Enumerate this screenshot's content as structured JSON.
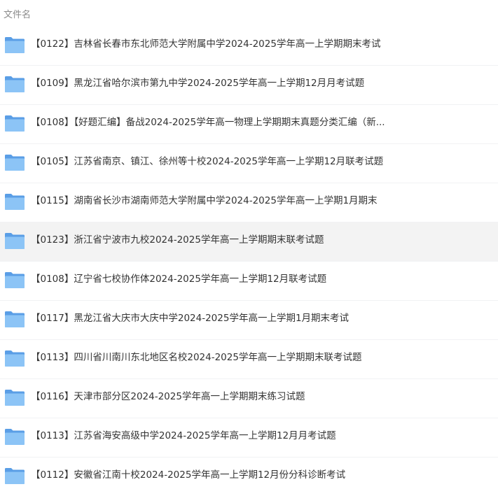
{
  "header": {
    "column_label": "文件名"
  },
  "colors": {
    "folder_back": "#5a9ee6",
    "folder_front": "#8cc4f6",
    "hover_row": "#f3f3f3",
    "text": "#333333"
  },
  "files": [
    {
      "name": "【0122】吉林省长春市东北师范大学附属中学2024-2025学年高一上学期期末考试",
      "icon": "folder-icon"
    },
    {
      "name": "【0109】黑龙江省哈尔滨市第九中学2024-2025学年高一上学期12月月考试题",
      "icon": "folder-icon"
    },
    {
      "name": "【0108】【好题汇编】备战2024-2025学年高一物理上学期期末真题分类汇编（新...",
      "icon": "folder-icon"
    },
    {
      "name": "【0105】江苏省南京、镇江、徐州等十校2024-2025学年高一上学期12月联考试题",
      "icon": "folder-icon"
    },
    {
      "name": "【0115】湖南省长沙市湖南师范大学附属中学2024-2025学年高一上学期1月期末",
      "icon": "folder-icon"
    },
    {
      "name": "【0123】浙江省宁波市九校2024-2025学年高一上学期期末联考试题",
      "icon": "folder-icon",
      "hovered": true
    },
    {
      "name": "【0108】辽宁省七校协作体2024-2025学年高一上学期12月联考试题",
      "icon": "folder-icon"
    },
    {
      "name": "【0117】黑龙江省大庆市大庆中学2024-2025学年高一上学期1月期末考试",
      "icon": "folder-icon"
    },
    {
      "name": "【0113】四川省川南川东北地区名校2024-2025学年高一上学期期末联考试题",
      "icon": "folder-icon"
    },
    {
      "name": "【0116】天津市部分区2024-2025学年高一上学期期末练习试题",
      "icon": "folder-icon"
    },
    {
      "name": "【0113】江苏省海安高级中学2024-2025学年高一上学期12月月考试题",
      "icon": "folder-icon"
    },
    {
      "name": "【0112】安徽省江南十校2024-2025学年高一上学期12月份分科诊断考试",
      "icon": "folder-icon"
    }
  ]
}
